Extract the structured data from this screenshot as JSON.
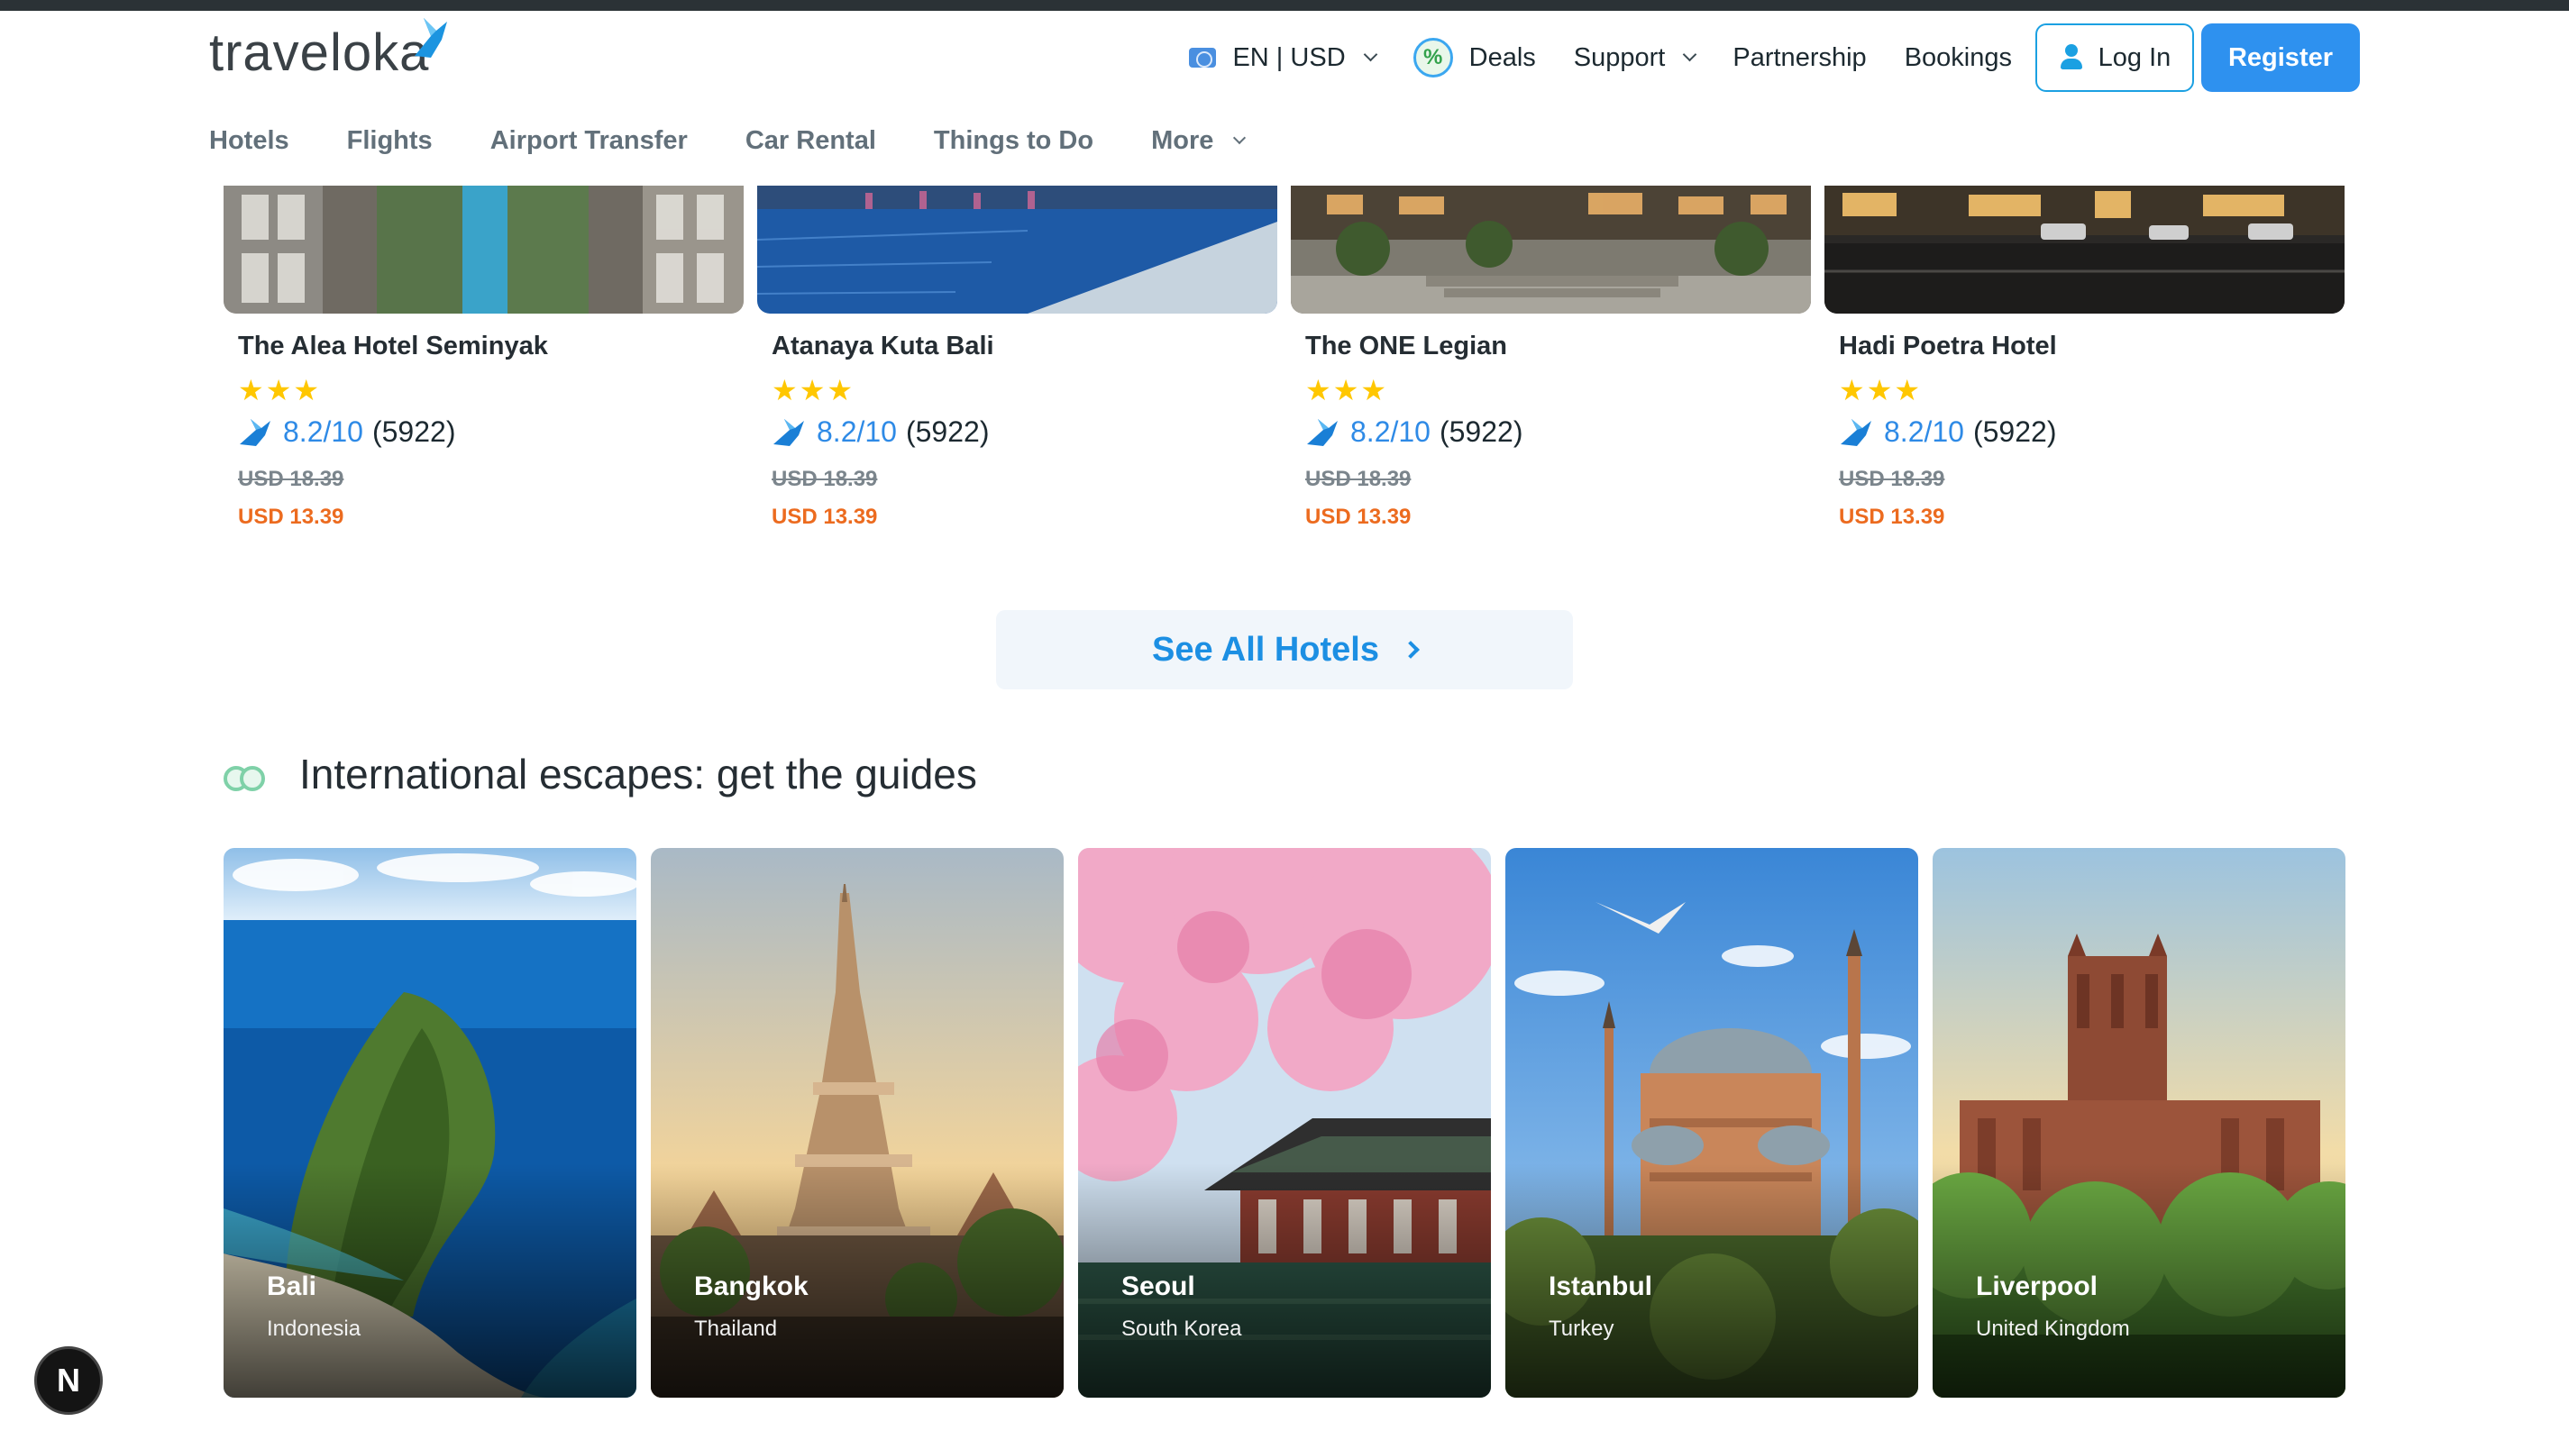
{
  "brand": {
    "logo_text": "traveloka",
    "accent": "#1ba0e2",
    "primary_button": "#2e91ef",
    "price_color": "#ec6b1f"
  },
  "topnav": {
    "language": "EN | USD",
    "deals": "Deals",
    "deals_icon_glyph": "%",
    "support": "Support",
    "partnership": "Partnership",
    "bookings": "Bookings",
    "login": "Log In",
    "register": "Register"
  },
  "subnav": {
    "hotels": "Hotels",
    "flights": "Flights",
    "airport_transfer": "Airport Transfer",
    "car_rental": "Car Rental",
    "things_to_do": "Things to Do",
    "more": "More"
  },
  "hotels": [
    {
      "name": "The Alea Hotel Seminyak",
      "stars": 3,
      "score": "8.2/10",
      "reviews": "(5922)",
      "price_old": "USD 18.39",
      "price_new": "USD 13.39"
    },
    {
      "name": "Atanaya Kuta Bali",
      "stars": 3,
      "score": "8.2/10",
      "reviews": "(5922)",
      "price_old": "USD 18.39",
      "price_new": "USD 13.39"
    },
    {
      "name": "The ONE Legian",
      "stars": 3,
      "score": "8.2/10",
      "reviews": "(5922)",
      "price_old": "USD 18.39",
      "price_new": "USD 13.39"
    },
    {
      "name": "Hadi Poetra Hotel",
      "stars": 3,
      "score": "8.2/10",
      "reviews": "(5922)",
      "price_old": "USD 18.39",
      "price_new": "USD 13.39"
    }
  ],
  "see_all": "See All Hotels",
  "guides_section": {
    "title": "International escapes: get the guides",
    "items": [
      {
        "city": "Bali",
        "country": "Indonesia"
      },
      {
        "city": "Bangkok",
        "country": "Thailand"
      },
      {
        "city": "Seoul",
        "country": "South Korea"
      },
      {
        "city": "Istanbul",
        "country": "Turkey"
      },
      {
        "city": "Liverpool",
        "country": "United Kingdom"
      }
    ]
  },
  "dev_badge": "N"
}
